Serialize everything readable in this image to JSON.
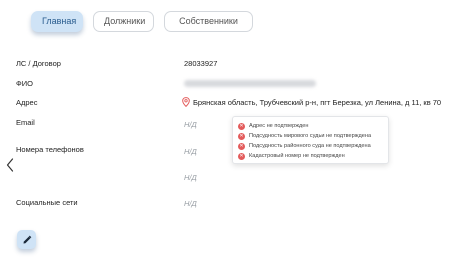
{
  "tabs": [
    {
      "label": "Главная",
      "active": true
    },
    {
      "label": "Должники",
      "active": false
    },
    {
      "label": "Собственники",
      "active": false
    }
  ],
  "fields": {
    "account": {
      "label": "ЛС / Договор",
      "value": "28033927"
    },
    "fio": {
      "label": "ФИО"
    },
    "address": {
      "label": "Адрес",
      "value": "Брянская область, Трубчевский р-н, пгт Березка, ул Ленина, д 11, кв 70"
    },
    "email": {
      "label": "Email",
      "value": "Н/Д"
    },
    "phones": {
      "label": "Номера телефонов",
      "value": "Н/Д",
      "value2": "Н/Д"
    },
    "social": {
      "label": "Социальные сети",
      "value": "Н/Д"
    }
  },
  "address_statuses": [
    "Адрес не подтвержден",
    "Подсудность мирового судьи не подтверждена",
    "Подсудность районного суда не подтверждена",
    "Кадастровый номер не подтвержден"
  ],
  "colors": {
    "accent_bg": "#cfe3f6",
    "accent_text": "#2a5d8f",
    "error": "#e35b5b",
    "muted": "#9aa0a6"
  },
  "icons": {
    "address": "map-pin-icon",
    "status": "error-circle-icon",
    "edit": "pencil-icon",
    "nav": "chevron-left-icon"
  }
}
